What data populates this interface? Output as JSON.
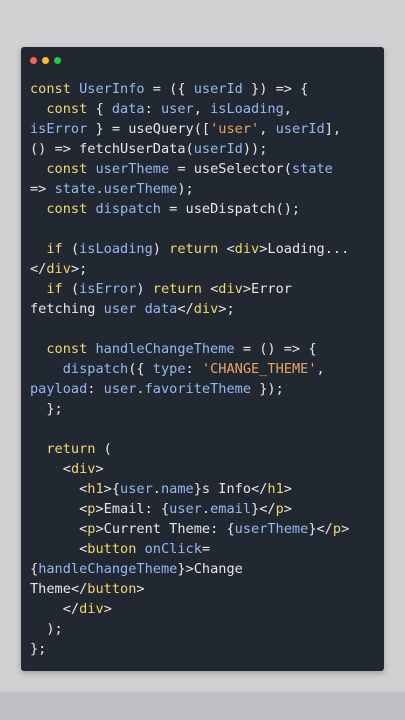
{
  "window": {
    "dots": [
      "red",
      "yellow",
      "green"
    ],
    "colors": {
      "background": "#222831",
      "keyword": "#f1d96f",
      "variable": "#95b8f3",
      "string": "#e7a564",
      "text": "#e6e6e6"
    }
  },
  "code": {
    "lines": [
      "const UserInfo = ({ userId }) => {",
      "  const { data: user, isLoading,",
      "isError } = useQuery(['user', userId],",
      "() => fetchUserData(userId));",
      "  const userTheme = useSelector(state",
      "=> state.userTheme);",
      "  const dispatch = useDispatch();",
      "",
      "  if (isLoading) return <div>Loading...",
      "</div>;",
      "  if (isError) return <div>Error",
      "fetching user data</div>;",
      "",
      "  const handleChangeTheme = () => {",
      "    dispatch({ type: 'CHANGE_THEME',",
      "payload: user.favoriteTheme });",
      "  };",
      "",
      "  return (",
      "    <div>",
      "      <h1>{user.name}'s Info</h1>",
      "      <p>Email: {user.email}</p>",
      "      <p>Current Theme: {userTheme}</p>",
      "      <button onClick=",
      "{handleChangeTheme}>Change",
      "Theme</button>",
      "    </div>",
      "  );",
      "};"
    ]
  }
}
